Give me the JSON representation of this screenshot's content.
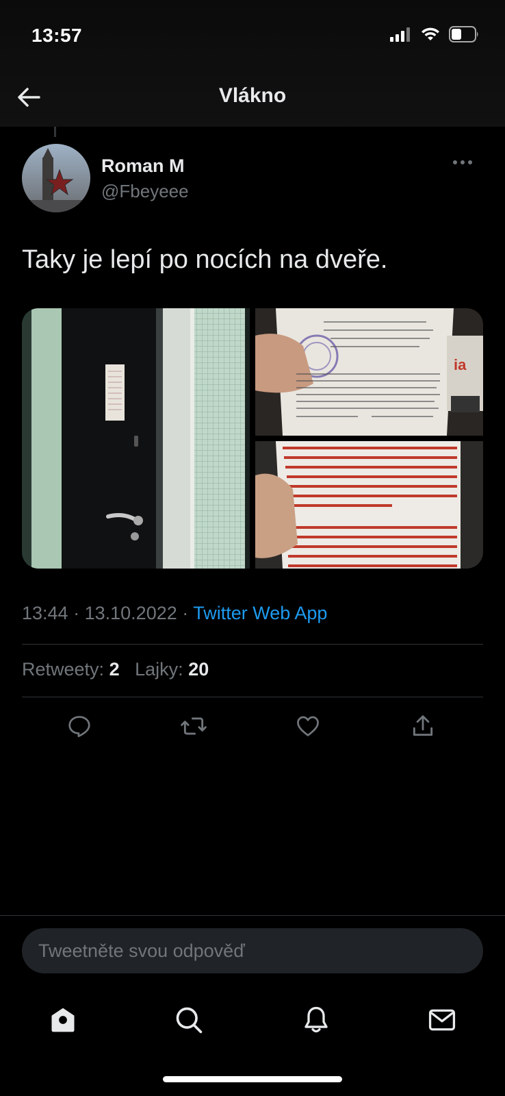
{
  "status_bar": {
    "time": "13:57",
    "icons": [
      "signal-icon",
      "wifi-icon",
      "battery-icon"
    ]
  },
  "header": {
    "title": "Vlákno",
    "back_icon": "arrow-left-icon"
  },
  "tweet": {
    "display_name": "Roman M",
    "handle": "@Fbeyeee",
    "text": "Taky je lepí po nocích na dveře.",
    "media": [
      {
        "name": "door-photo",
        "document_lines": []
      },
      {
        "name": "summons-document-photo",
        "document_lines": [
          "Явиться по адресу",
          "При себе иметь паспорт, военный билет",
          "О явке в военный комиссариат Бутовского района ЮЗАО г. Москвы на",
          "мероприятия связанные с мобилизацией, назначенные с 10 по 16 ноября",
          "2022 года к 9.00 часам, оповещен.",
          "В случае не явки в военный комиссариат, по уважительной причине,",
          "обязуюсь явится по окончании действия уважительной причины в военный",
          "комиссариат незамедлительно, без дополнительного вызова."
        ]
      },
      {
        "name": "summons-warning-photo",
        "document_lines": [
          "На Вас выписана повестка, про...",
          "военкомат, за неявку Вы будете нести",
          "ответственность в соответствии с",
          "законодательством Российской Федерации",
          "статьей 31 пункта 1,4 ФЗ «О воинской",
          "обязанности и военной службе» статьей 21.5",
          "КоАП РФ; статьей 328 УК РФ.",
          "Уклонение от призыва на военную службу при",
          "отсутствии законных оснований для",
          "освобождения от нее влечет штраф в размере до",
          "200 тыс. руб. или в размере заработной платы",
          "... осужденного за период до 18"
        ]
      }
    ],
    "time": "13:44",
    "date": "13.10.2022",
    "separator": "·",
    "source": "Twitter Web App",
    "retweets_label": "Retweety:",
    "retweets_count": "2",
    "likes_label": "Lajky:",
    "likes_count": "20"
  },
  "actions": [
    "reply-icon",
    "retweet-icon",
    "like-icon",
    "share-icon"
  ],
  "reply": {
    "placeholder": "Tweetněte svou odpověď"
  },
  "bottom_nav": [
    "home-icon",
    "search-icon",
    "notifications-icon",
    "messages-icon"
  ],
  "colors": {
    "accent": "#1d9bf0",
    "background": "#000000",
    "muted": "#71767b",
    "text": "#e7e9ea"
  }
}
